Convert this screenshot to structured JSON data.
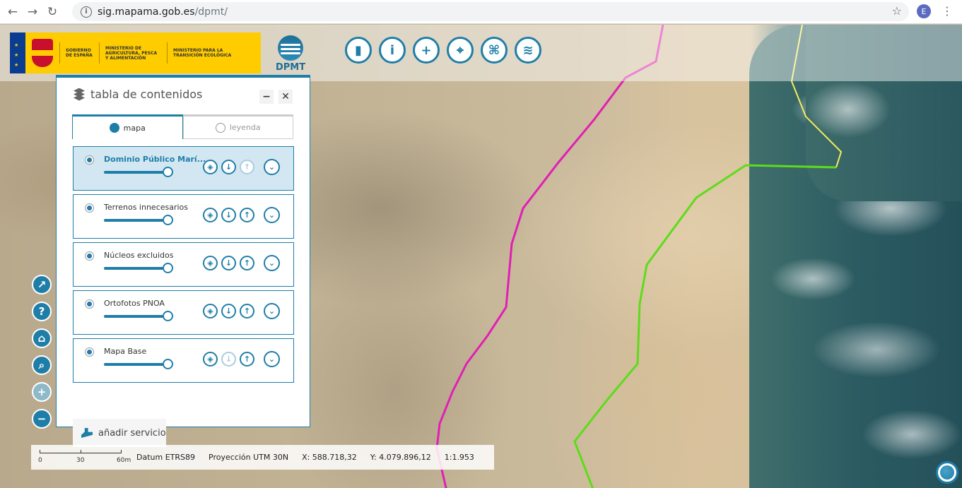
{
  "browser": {
    "url_host": "sig.mapama.gob.es",
    "url_path": "/dpmt/",
    "profile_initial": "E",
    "back_icon": "arrow-left-icon",
    "forward_icon": "arrow-right-icon",
    "reload_icon": "reload-icon"
  },
  "header": {
    "gov_label": "GOBIERNO DE ESPAÑA",
    "ministry1": "MINISTERIO DE AGRICULTURA, PESCA Y ALIMENTACIÓN",
    "ministry2": "MINISTERIO PARA LA TRANSICIÓN ECOLÓGICA",
    "app_logo_text": "DPMT",
    "toolbar": [
      "ruler-icon",
      "info-icon",
      "bookmark-icon",
      "map-pin-icon",
      "hierarchy-icon",
      "layers-icon"
    ]
  },
  "panel": {
    "title": "tabla de contenidos",
    "minimize": "−",
    "close": "✕",
    "tabs": [
      {
        "label": "mapa",
        "active": true
      },
      {
        "label": "leyenda",
        "active": false
      }
    ],
    "layers": [
      {
        "name": "Dominio Público Marí...",
        "selected": true,
        "opacity": 1.0,
        "download_enabled": true,
        "upload_enabled": false
      },
      {
        "name": "Terrenos innecesarios",
        "selected": false,
        "opacity": 1.0,
        "download_enabled": true,
        "upload_enabled": true
      },
      {
        "name": "Núcleos excluidos",
        "selected": false,
        "opacity": 1.0,
        "download_enabled": true,
        "upload_enabled": true
      },
      {
        "name": "Ortofotos PNOA",
        "selected": false,
        "opacity": 1.0,
        "download_enabled": true,
        "upload_enabled": true
      },
      {
        "name": "Mapa Base",
        "selected": false,
        "opacity": 1.0,
        "download_enabled": false,
        "upload_enabled": true
      }
    ],
    "add_service": "añadir servicio"
  },
  "map_controls": [
    "share-icon",
    "help-icon",
    "home-icon",
    "zoom-search-icon",
    "zoom-in-icon",
    "zoom-out-icon"
  ],
  "statusbar": {
    "scale_labels": [
      "0",
      "30",
      "60m"
    ],
    "datum": "Datum ETRS89",
    "projection": "Proyección UTM 30N",
    "x": "X: 588.718,32",
    "y": "Y: 4.079.896,12",
    "scale": "1:1.953"
  },
  "colors": {
    "accent": "#1f7ea8",
    "line_magenta": "#e01fb4",
    "line_green": "#5ddc1a",
    "line_yellow": "#f5ee5a"
  }
}
